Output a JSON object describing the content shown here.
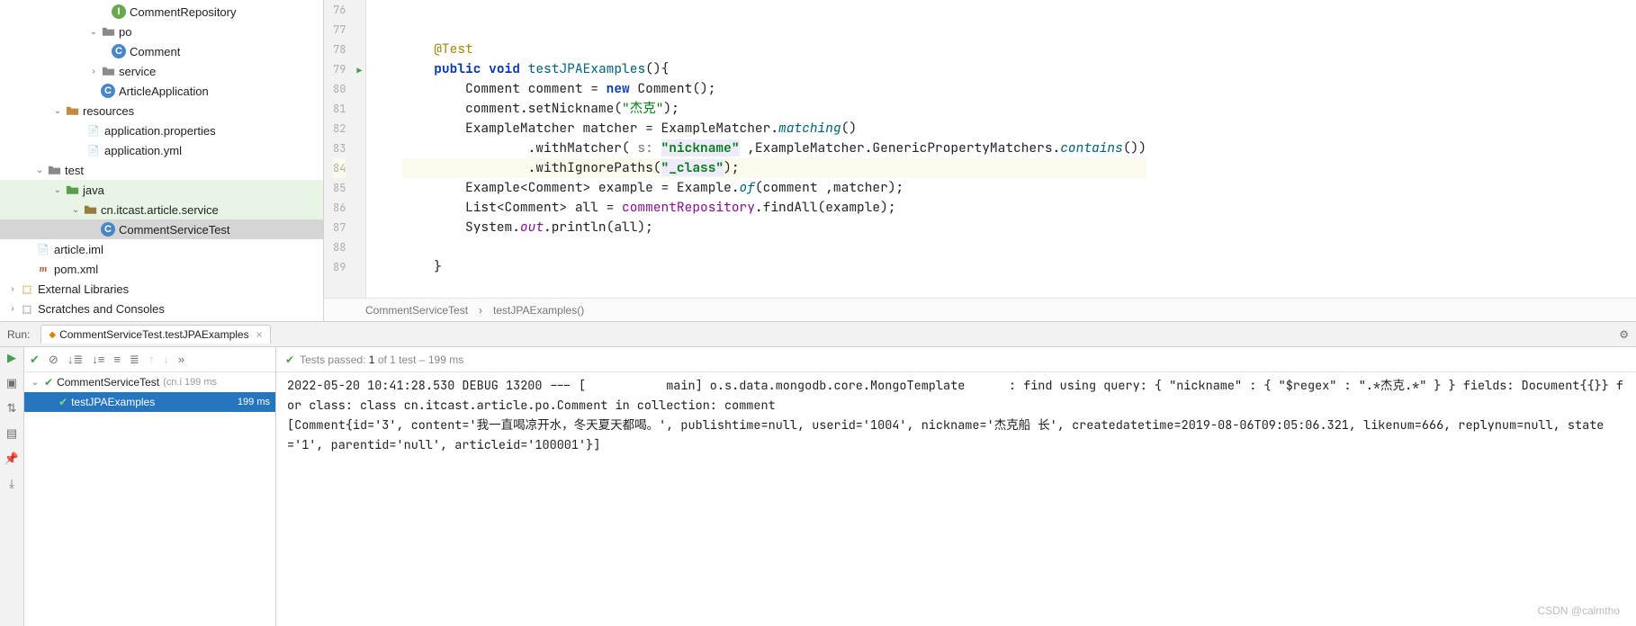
{
  "tree": {
    "comment_repository": "CommentRepository",
    "po": "po",
    "comment": "Comment",
    "service": "service",
    "article_application": "ArticleApplication",
    "resources": "resources",
    "app_props": "application.properties",
    "app_yml": "application.yml",
    "test": "test",
    "java": "java",
    "pkg": "cn.itcast.article.service",
    "comment_service_test": "CommentServiceTest",
    "article_iml": "article.iml",
    "pom": "pom.xml",
    "external_libs": "External Libraries",
    "scratches": "Scratches and Consoles"
  },
  "gutter": [
    "76",
    "77",
    "78",
    "79",
    "80",
    "81",
    "82",
    "83",
    "84",
    "85",
    "86",
    "87",
    "88",
    "89"
  ],
  "breadcrumb": {
    "a": "CommentServiceTest",
    "sep": "›",
    "b": "testJPAExamples()"
  },
  "run": {
    "title": "Run:",
    "tab": "CommentServiceTest.testJPAExamples",
    "status_prefix": "Tests passed:",
    "status_count": "1",
    "status_of": "of 1 test – 199 ms",
    "root_test": "CommentServiceTest",
    "root_meta": "(cn.i 199 ms",
    "child_test": "testJPAExamples",
    "child_ms": "199 ms"
  },
  "console": "2022-05-20 10:41:28.530 DEBUG 13200 --- [           main] o.s.data.mongodb.core.MongoTemplate      : find using query: { \"nickname\" : { \"$regex\" : \".*杰克.*\" } } fields: Document{{}} for class: class cn.itcast.article.po.Comment in collection: comment\n[Comment{id='3', content='我一直喝凉开水，冬天夏天都喝。', publishtime=null, userid='1004', nickname='杰克船 长', createdatetime=2019-08-06T09:05:06.321, likenum=666, replynum=null, state='1', parentid='null', articleid='100001'}]",
  "watermark": "CSDN @calmtho",
  "code": {
    "l78_ann": "@Test",
    "l79_kw1": "public",
    "l79_kw2": "void",
    "l79_m": "testJPAExamples",
    "l80_a": "Comment comment = ",
    "l80_kw": "new",
    "l80_b": " Comment();",
    "l81_a": "comment.setNickname(",
    "l81_s": "\"杰克\"",
    "l81_b": ");",
    "l82_a": "ExampleMatcher matcher = ExampleMatcher.",
    "l82_m": "matching",
    "l82_b": "()",
    "l83_a": ".withMatcher(",
    "l83_p": " s: ",
    "l83_s": "\"nickname\"",
    "l83_b": " ,ExampleMatcher.GenericPropertyMatchers.",
    "l83_m": "contains",
    "l83_c": "())",
    "l84_a": ".withIgnorePaths(",
    "l84_s": "\"_class\"",
    "l84_b": ");",
    "l85_a": "Example<Comment> example = Example.",
    "l85_m": "of",
    "l85_b": "(comment ,matcher);",
    "l86_a": "List<Comment> all = ",
    "l86_f": "commentRepository",
    "l86_b": ".findAll(example);",
    "l87_a": "System.",
    "l87_f": "out",
    "l87_b": ".println(all);"
  }
}
